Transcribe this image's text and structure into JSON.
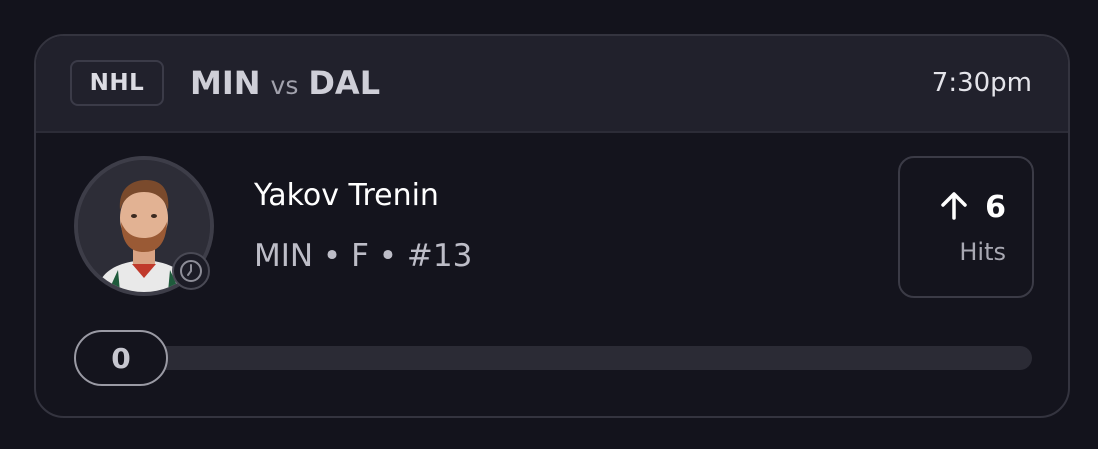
{
  "header": {
    "league": "NHL",
    "home_team": "MIN",
    "vs_label": "vs",
    "away_team": "DAL",
    "time": "7:30pm"
  },
  "player": {
    "name": "Yakov Trenin",
    "meta": "MIN • F • #13",
    "avatar_icon": "player-headshot",
    "status_icon": "clock-icon"
  },
  "stat": {
    "direction_icon": "arrow-up-icon",
    "value": "6",
    "label": "Hits"
  },
  "progress": {
    "current_label": "0",
    "current": 0,
    "target": 6
  },
  "colors": {
    "background": "#13131c",
    "header": "#21212c",
    "card_border": "#34343f",
    "track": "#2b2b35"
  }
}
